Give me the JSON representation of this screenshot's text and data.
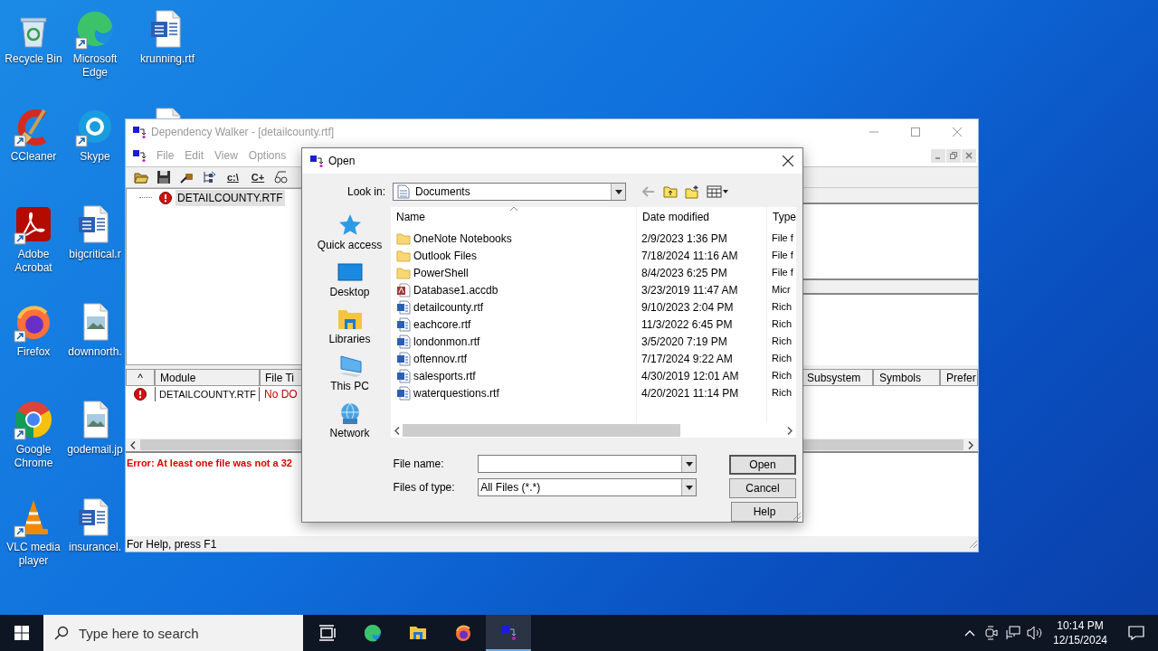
{
  "desktop": {
    "columns": [
      [
        {
          "label": "Recycle Bin",
          "kind": "recycle",
          "shortcut": false
        },
        {
          "label": "CCleaner",
          "kind": "ccleaner",
          "shortcut": true
        },
        {
          "label": "Adobe Acrobat",
          "kind": "acrobat",
          "shortcut": true
        },
        {
          "label": "Firefox",
          "kind": "firefox",
          "shortcut": true
        },
        {
          "label": "Google Chrome",
          "kind": "chrome",
          "shortcut": true
        },
        {
          "label": "VLC media player",
          "kind": "vlc",
          "shortcut": true
        }
      ],
      [
        {
          "label": "Microsoft Edge",
          "kind": "edge",
          "shortcut": true
        },
        {
          "label": "Skype",
          "kind": "skype",
          "shortcut": true
        },
        {
          "label": "bigcritical.r",
          "kind": "word",
          "shortcut": false
        },
        {
          "label": "downnorth.",
          "kind": "image",
          "shortcut": false
        },
        {
          "label": "godemail.jp",
          "kind": "image",
          "shortcut": false
        },
        {
          "label": "insurancel.",
          "kind": "word",
          "shortcut": false
        }
      ],
      [
        {
          "label": "krunning.rtf",
          "kind": "word",
          "shortcut": false
        },
        {
          "kind": "file"
        }
      ]
    ]
  },
  "dependency_walker": {
    "title": "Dependency Walker - [detailcounty.rtf]",
    "menu": [
      "File",
      "Edit",
      "View",
      "Options"
    ],
    "toolbar": [
      {
        "kind": "open"
      },
      {
        "kind": "save"
      },
      {
        "kind": "find"
      },
      {
        "kind": "tree"
      },
      {
        "kind": "text",
        "label": "c:\\"
      },
      {
        "kind": "text",
        "label": "C+"
      },
      {
        "kind": "glasses"
      }
    ],
    "tree": [
      {
        "label": "DETAILCOUNTY.RTF",
        "kind": "error",
        "selected": true
      }
    ],
    "module_columns": [
      "^",
      "Module",
      "File Ti",
      "Subsystem",
      "Symbols",
      "Prefer"
    ],
    "modules": [
      {
        "kind": "error",
        "module": "DETAILCOUNTY.RTF",
        "file_time": "No DO"
      }
    ],
    "log": [
      {
        "kind": "error",
        "text": "Error: At least one file was not a 32"
      }
    ],
    "status_bar": "For Help, press F1"
  },
  "open_dialog": {
    "title": "Open",
    "look_in_label": "Look in:",
    "look_in": "Documents",
    "places": [
      {
        "label": "Quick access",
        "kind": "star"
      },
      {
        "label": "Desktop",
        "kind": "desktop"
      },
      {
        "label": "Libraries",
        "kind": "libraries"
      },
      {
        "label": "This PC",
        "kind": "pc"
      },
      {
        "label": "Network",
        "kind": "network"
      }
    ],
    "columns": [
      "Name",
      "Date modified",
      "Type"
    ],
    "files": [
      {
        "name": "OneNote Notebooks",
        "kind": "folder",
        "date": "2/9/2023 1:36 PM",
        "type": "File f"
      },
      {
        "name": "Outlook Files",
        "kind": "folder",
        "date": "7/18/2024 11:16 AM",
        "type": "File f"
      },
      {
        "name": "PowerShell",
        "kind": "folder",
        "date": "8/4/2023 6:25 PM",
        "type": "File f"
      },
      {
        "name": "Database1.accdb",
        "kind": "database",
        "date": "3/23/2019 11:47 AM",
        "type": "Micr"
      },
      {
        "name": "detailcounty.rtf",
        "kind": "document",
        "date": "9/10/2023 2:04 PM",
        "type": "Rich"
      },
      {
        "name": "eachcore.rtf",
        "kind": "document",
        "date": "11/3/2022 6:45 PM",
        "type": "Rich"
      },
      {
        "name": "londonmon.rtf",
        "kind": "document",
        "date": "3/5/2020 7:19 PM",
        "type": "Rich"
      },
      {
        "name": "oftennov.rtf",
        "kind": "document",
        "date": "7/17/2024 9:22 AM",
        "type": "Rich"
      },
      {
        "name": "salesports.rtf",
        "kind": "document",
        "date": "4/30/2019 12:01 AM",
        "type": "Rich"
      },
      {
        "name": "waterquestions.rtf",
        "kind": "document",
        "date": "4/20/2021 11:14 PM",
        "type": "Rich"
      }
    ],
    "file_name_label": "File name:",
    "file_type_label": "Files of type:",
    "file_type": "All Files (*.*)",
    "buttons": [
      {
        "label": "Open",
        "default": true
      },
      {
        "label": "Cancel",
        "default": false
      },
      {
        "label": "Help",
        "default": false
      }
    ]
  },
  "taskbar": {
    "search_placeholder": "Type here to search",
    "apps": [
      {
        "kind": "taskview",
        "active": false
      },
      {
        "kind": "edge",
        "active": false
      },
      {
        "kind": "explorer",
        "active": false
      },
      {
        "kind": "firefox",
        "active": false
      },
      {
        "kind": "depends",
        "active": true
      }
    ],
    "time": "10:14 PM",
    "date": "12/15/2024"
  }
}
